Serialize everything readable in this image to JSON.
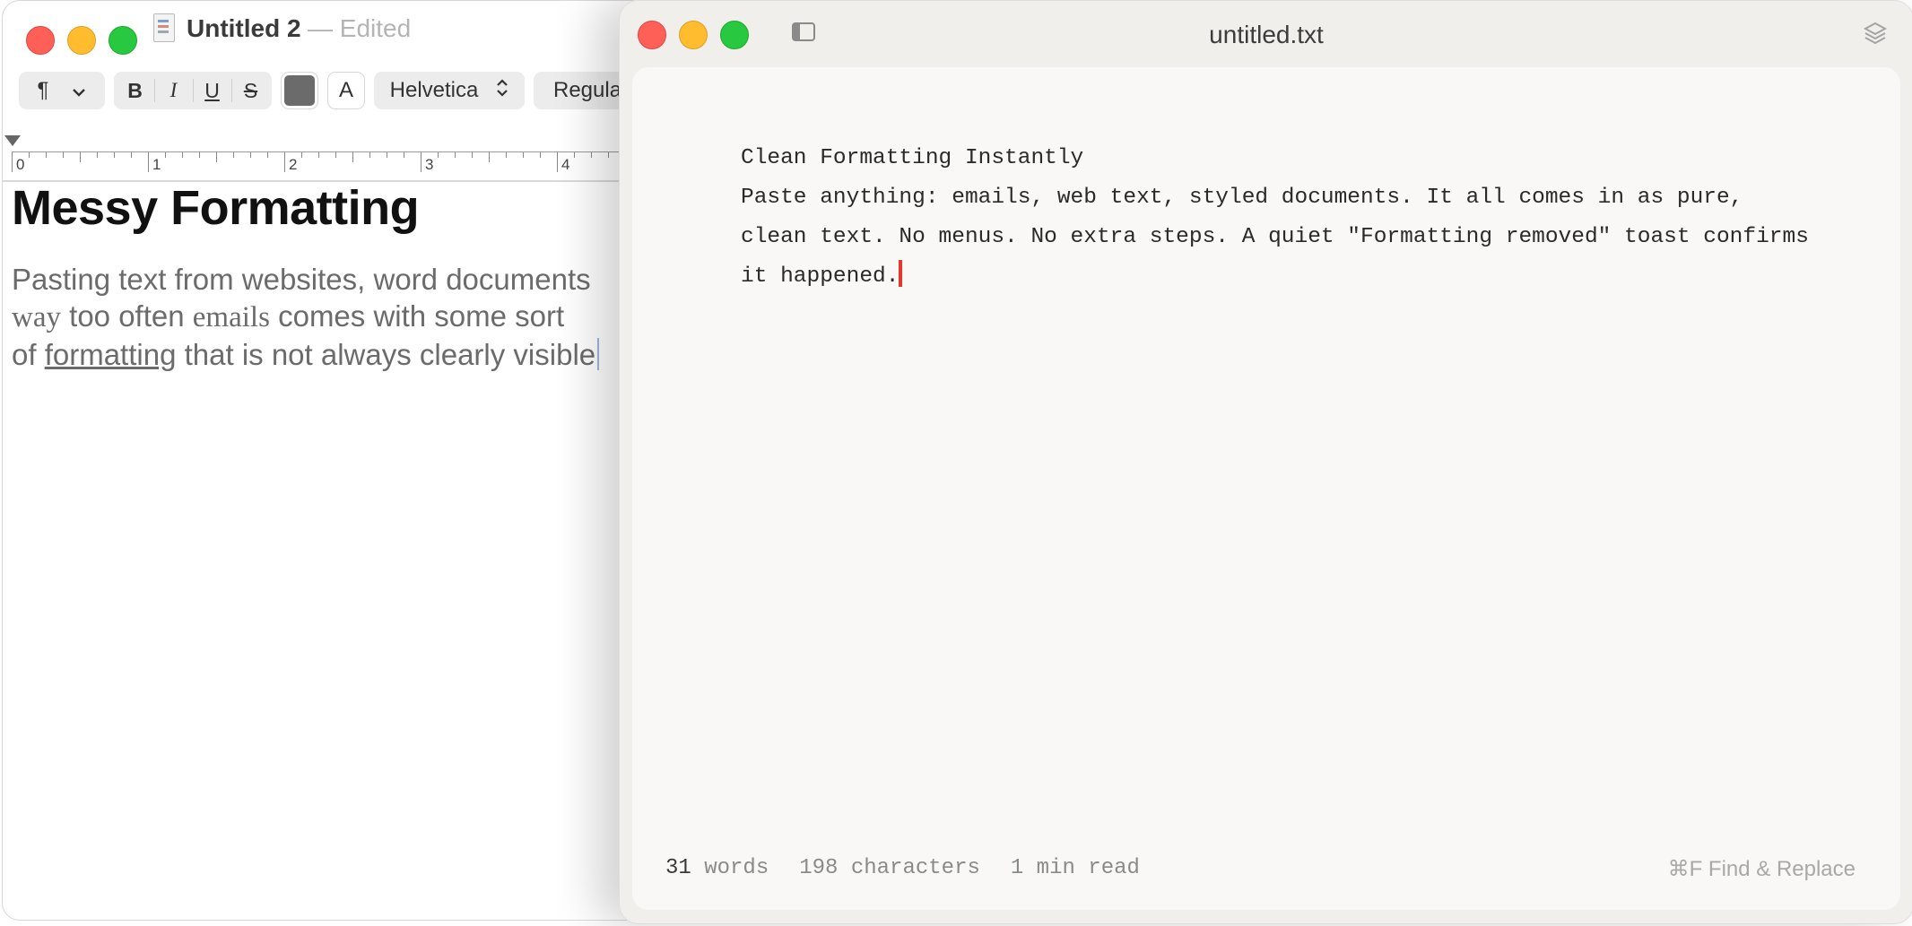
{
  "left_window": {
    "title": "Untitled 2",
    "title_separator": "—",
    "status": "Edited",
    "toolbar": {
      "paragraph_symbol": "¶",
      "bold": "B",
      "italic": "I",
      "underline": "U",
      "strikethrough": "S",
      "text_color": "#6b6b6b",
      "highlight_label": "A",
      "font_family": "Helvetica",
      "font_style": "Regular"
    },
    "ruler": {
      "numbers": [
        "0",
        "1",
        "2",
        "3",
        "4"
      ]
    },
    "document": {
      "heading": "Messy Formatting",
      "line1": "Pasting text from websites, word documents",
      "line2_a": "way",
      "line2_b": " too often ",
      "line2_c": "emails",
      "line2_d": " comes with some sort",
      "line3_a": "of ",
      "line3_b": "formatting",
      "line3_c": " that is not always clearly visible"
    }
  },
  "right_window": {
    "title": "untitled.txt",
    "content": {
      "line1": "Clean Formatting Instantly",
      "line2": "Paste anything: emails, web text, styled documents. It all comes in as pure,",
      "line3": "clean text. No menus. No extra steps. A quiet \"Formatting removed\" toast confirms",
      "line4": "it happened."
    },
    "status_bar": {
      "word_count": "31",
      "words_label": "words",
      "characters": "198 characters",
      "read_time": "1 min read",
      "find_replace": "⌘F  Find & Replace"
    },
    "cursor_color": "#e4382c"
  }
}
